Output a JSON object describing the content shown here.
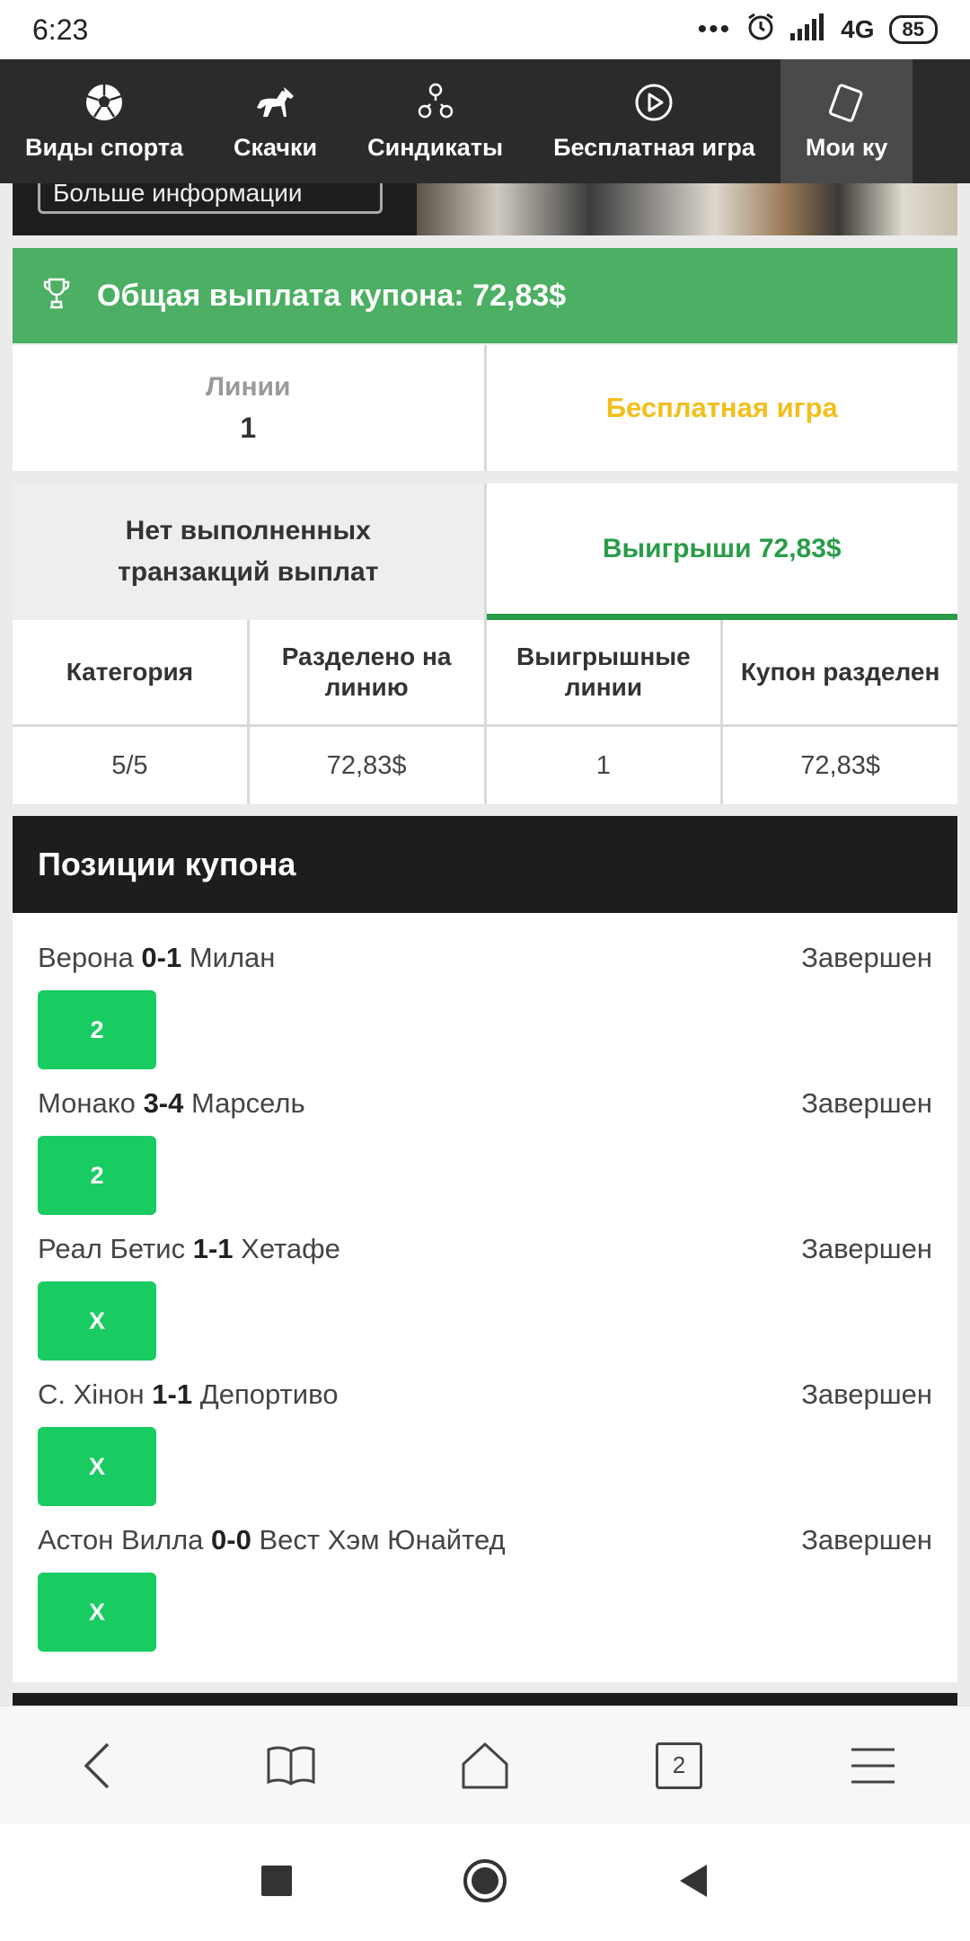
{
  "status_bar": {
    "time": "6:23",
    "network": "4G",
    "battery": "85"
  },
  "nav": {
    "items": [
      {
        "label": "Виды спорта",
        "icon": "soccer-ball-icon"
      },
      {
        "label": "Скачки",
        "icon": "horse-icon"
      },
      {
        "label": "Синдикаты",
        "icon": "group-icon"
      },
      {
        "label": "Бесплатная игра",
        "icon": "play-icon"
      },
      {
        "label": "Мои ку",
        "icon": "coupon-icon"
      }
    ]
  },
  "hero": {
    "button_label": "Больше информации"
  },
  "banner": {
    "title": "Общая выплата купона: 72,83$",
    "icon": "trophy-icon"
  },
  "summary": {
    "lines_label": "Линии",
    "lines_value": "1",
    "free_game": "Бесплатная игра"
  },
  "tabs": {
    "no_transactions": "Нет выполненных транзакций выплат",
    "winnings": "Выигрыши 72,83$"
  },
  "table": {
    "headers": [
      "Категория",
      "Разделено на линию",
      "Выигрышные линии",
      "Купон разделен"
    ],
    "row": [
      "5/5",
      "72,83$",
      "1",
      "72,83$"
    ]
  },
  "positions": {
    "title": "Позиции купона",
    "items": [
      {
        "home": "Верона",
        "score": "0-1",
        "away": "Милан",
        "status": "Завершен",
        "pick": "2"
      },
      {
        "home": "Монако",
        "score": "3-4",
        "away": "Марсель",
        "status": "Завершен",
        "pick": "2"
      },
      {
        "home": "Реал Бетис",
        "score": "1-1",
        "away": "Хетафе",
        "status": "Завершен",
        "pick": "X"
      },
      {
        "home": "С. Хiнон",
        "score": "1-1",
        "away": "Депортиво",
        "status": "Завершен",
        "pick": "X"
      },
      {
        "home": "Астон Вилла",
        "score": "0-0",
        "away": "Вест Хэм Юнайтед",
        "status": "Завершен",
        "pick": "X"
      }
    ]
  },
  "browser_bar": {
    "tabs_count": "2"
  }
}
